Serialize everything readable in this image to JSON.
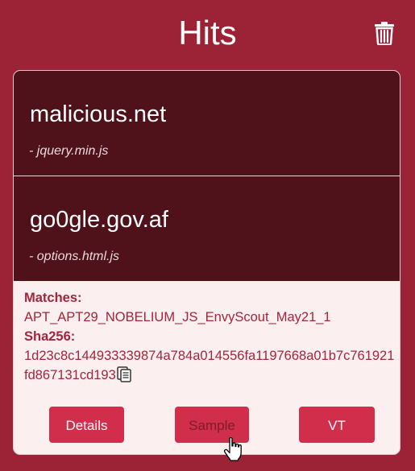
{
  "header": {
    "title": "Hits",
    "delete_icon": "trash-icon"
  },
  "hits": [
    {
      "domain": "malicious.net",
      "file": "- jquery.min.js"
    },
    {
      "domain": "go0gle.gov.af",
      "file": "- options.html.js"
    }
  ],
  "detail": {
    "matches_label": "Matches:",
    "matches_value": "APT_APT29_NOBELIUM_JS_EnvyScout_May21_1",
    "sha_label": "Sha256:",
    "sha_value": "1d23c8c144933339874a784a014556fa1197668a01b7c761921fd867131cd193",
    "copy_icon": "copy-icon"
  },
  "buttons": {
    "details": "Details",
    "sample": "Sample",
    "vt": "VT"
  },
  "colors": {
    "background": "#9c2335",
    "hit_background": "#4f111a",
    "detail_background": "#fbeff0",
    "accent": "#d02e4a"
  }
}
